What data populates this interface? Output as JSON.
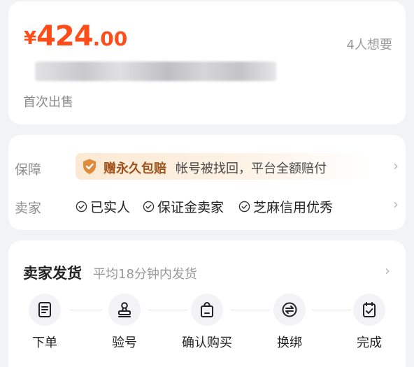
{
  "price": {
    "currency": "¥",
    "integer": "424",
    "decimal": ".00",
    "color": "#ff4d1a"
  },
  "wants": "4人想要",
  "first_sale": "首次出售",
  "guarantee": {
    "label": "保障",
    "highlight": "赠永久包赔",
    "text": "帐号被找回，平台全额赔付"
  },
  "seller": {
    "label": "卖家",
    "badges": [
      "已实人",
      "保证金卖家",
      "芝麻信用优秀"
    ]
  },
  "shipping": {
    "title": "卖家发货",
    "subtitle": "平均18分钟内发货",
    "steps": [
      {
        "label": "下单",
        "icon": "order-list-icon"
      },
      {
        "label": "验号",
        "icon": "stamp-icon"
      },
      {
        "label": "确认购买",
        "icon": "shopping-bag-icon"
      },
      {
        "label": "换绑",
        "icon": "swap-icon"
      },
      {
        "label": "完成",
        "icon": "check-calendar-icon"
      }
    ]
  }
}
